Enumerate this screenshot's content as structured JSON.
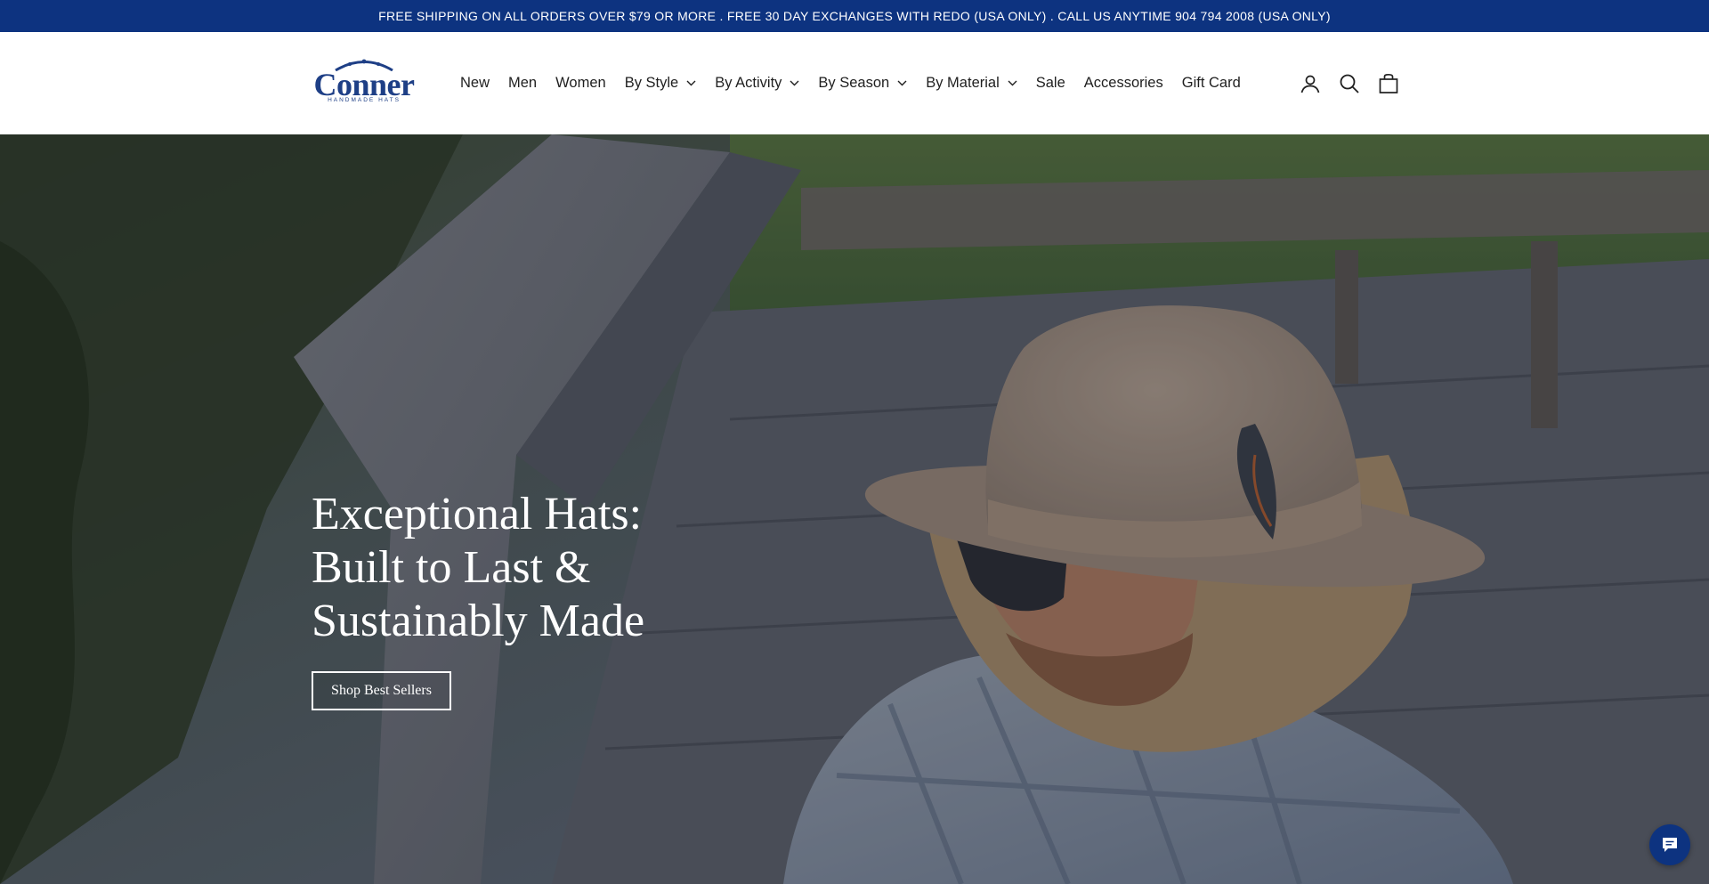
{
  "announcement": {
    "text": "FREE SHIPPING ON ALL ORDERS OVER $79 OR MORE . FREE 30 DAY EXCHANGES WITH REDO (USA ONLY) . CALL US ANYTIME 904 794 2008 (USA ONLY)"
  },
  "logo": {
    "wordmark": "Conner",
    "tagline": "HANDMADE HATS"
  },
  "nav": {
    "items": [
      {
        "label": "New"
      },
      {
        "label": "Men"
      },
      {
        "label": "Women"
      },
      {
        "label": "By Style",
        "icon": "chevron-down-icon"
      },
      {
        "label": "By Activity",
        "icon": "chevron-down-icon"
      },
      {
        "label": "By Season",
        "icon": "chevron-down-icon"
      },
      {
        "label": "By Material",
        "icon": "chevron-down-icon"
      },
      {
        "label": "Sale"
      },
      {
        "label": "Accessories"
      },
      {
        "label": "Gift Card"
      }
    ]
  },
  "header_icons": [
    "account-icon",
    "search-icon",
    "cart-icon"
  ],
  "hero": {
    "headline_lines": [
      "Exceptional Hats:",
      "Built to Last &",
      "Sustainably Made"
    ],
    "cta_label": "Shop Best Sellers"
  },
  "chat": {
    "icon": "chat-icon"
  },
  "colors": {
    "brand_navy": "#0d3380",
    "logo_blue": "#1e3f86",
    "text": "#1f1f1f",
    "white": "#ffffff"
  }
}
